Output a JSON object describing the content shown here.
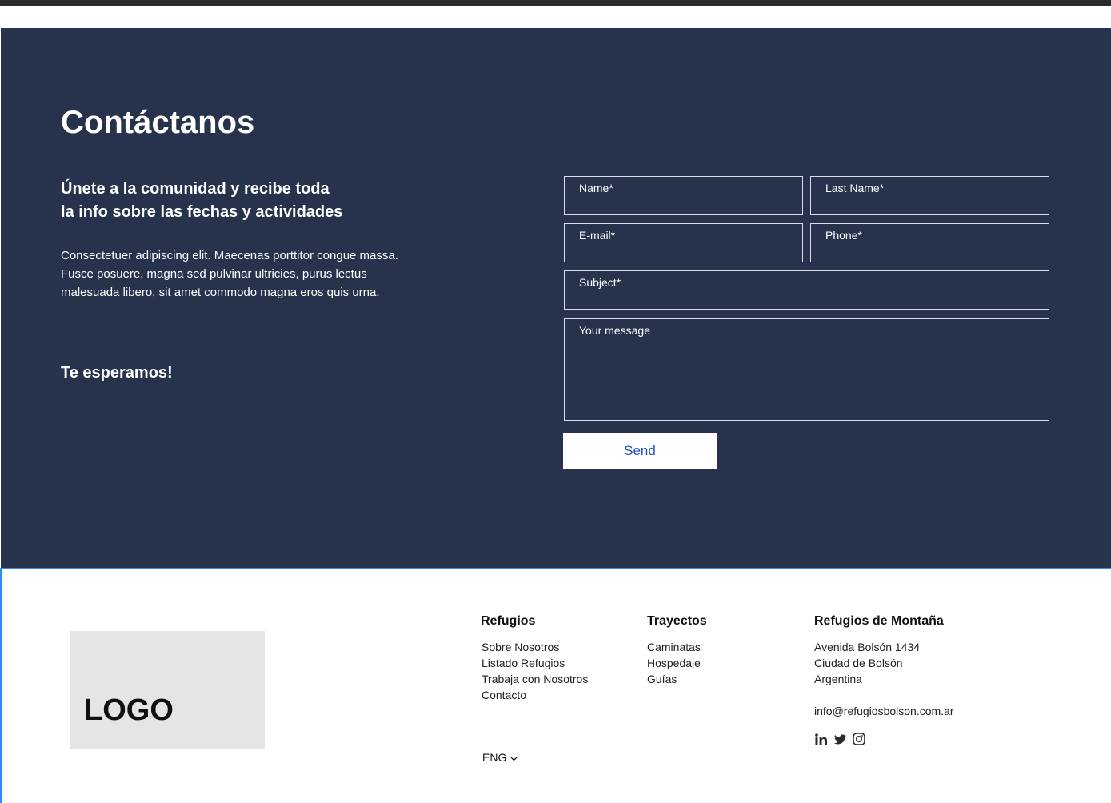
{
  "contact": {
    "title": "Contáctanos",
    "subtitle_line1": "Únete a la comunidad y recibe toda",
    "subtitle_line2": "la info sobre las fechas y actividades",
    "body": "Consectetuer adipiscing elit. Maecenas porttitor congue massa. Fusce posuere, magna sed pulvinar ultricies, purus lectus malesuada libero, sit amet commodo magna eros quis urna.",
    "closing": "Te esperamos!"
  },
  "form": {
    "name_label": "Name*",
    "last_name_label": "Last Name*",
    "email_label": "E-mail*",
    "phone_label": "Phone*",
    "subject_label": "Subject*",
    "message_label": "Your message",
    "send_label": "Send"
  },
  "footer": {
    "logo": "LOGO",
    "refugios": {
      "heading": "Refugios",
      "links": [
        "Sobre Nosotros",
        "Listado Refugios",
        "Trabaja con Nosotros",
        "Contacto"
      ]
    },
    "trayectos": {
      "heading": "Trayectos",
      "links": [
        "Caminatas",
        "Hospedaje",
        "Guías"
      ]
    },
    "company": {
      "heading": "Refugios de Montaña",
      "address": [
        "Avenida Bolsón 1434",
        "Ciudad de Bolsón",
        "Argentina"
      ],
      "email": "info@refugiosbolson.com.ar"
    },
    "social_icons": [
      "linkedin-icon",
      "twitter-icon",
      "instagram-icon"
    ],
    "language": "ENG"
  },
  "colors": {
    "contact_bg": "#27334d",
    "accent_blue": "#1f4fc4",
    "logo_bg": "#e5e5e5",
    "footer_border": "#2f8ff0"
  }
}
